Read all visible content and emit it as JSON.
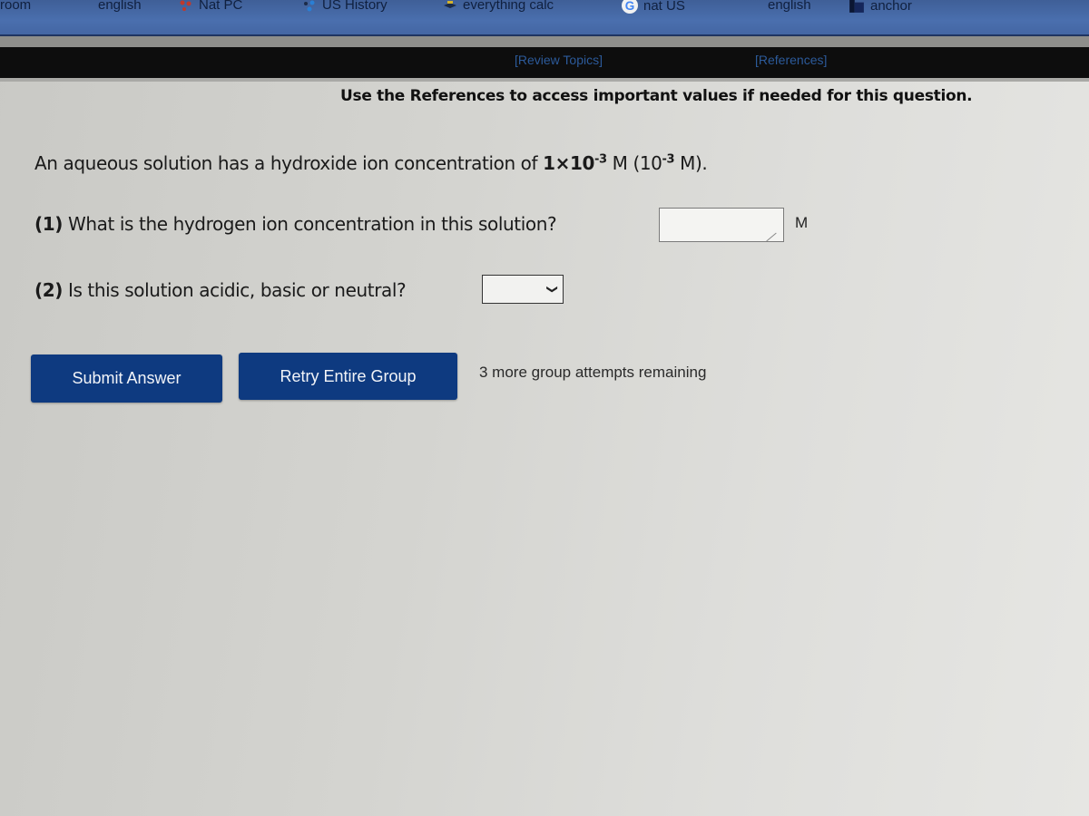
{
  "bookmarks": [
    {
      "label": "room",
      "icon": "none"
    },
    {
      "label": "english",
      "icon": "none"
    },
    {
      "label": "Nat PC",
      "icon": "colored-dots-icon"
    },
    {
      "label": "US History",
      "icon": "colored-dots-icon"
    },
    {
      "label": "everything calc",
      "icon": "bird-icon"
    },
    {
      "label": "nat US",
      "icon": "google-icon"
    },
    {
      "label": "english",
      "icon": "none"
    },
    {
      "label": "anchor",
      "icon": "page-icon"
    }
  ],
  "references_bar": {
    "review_topics": "[Review Topics]",
    "references": "[References]"
  },
  "instruction": "Use the References to access important values if needed for this question.",
  "question": {
    "stem_prefix": "An aqueous solution has a hydroxide ion concentration of ",
    "value_mantissa": "1×10",
    "value_exponent": "-3",
    "unit_part": " M (10",
    "alt_exponent": "-3",
    "suffix": " M).",
    "part1_number": "(1)",
    "part1_text": " What is the hydrogen ion concentration in this solution?",
    "part1_value": "",
    "part1_unit": "M",
    "part2_number": "(2)",
    "part2_text": " Is this solution acidic, basic or neutral?",
    "part2_selected": ""
  },
  "actions": {
    "submit_label": "Submit Answer",
    "retry_label": "Retry Entire Group",
    "attempts_text": "3 more group attempts remaining"
  }
}
